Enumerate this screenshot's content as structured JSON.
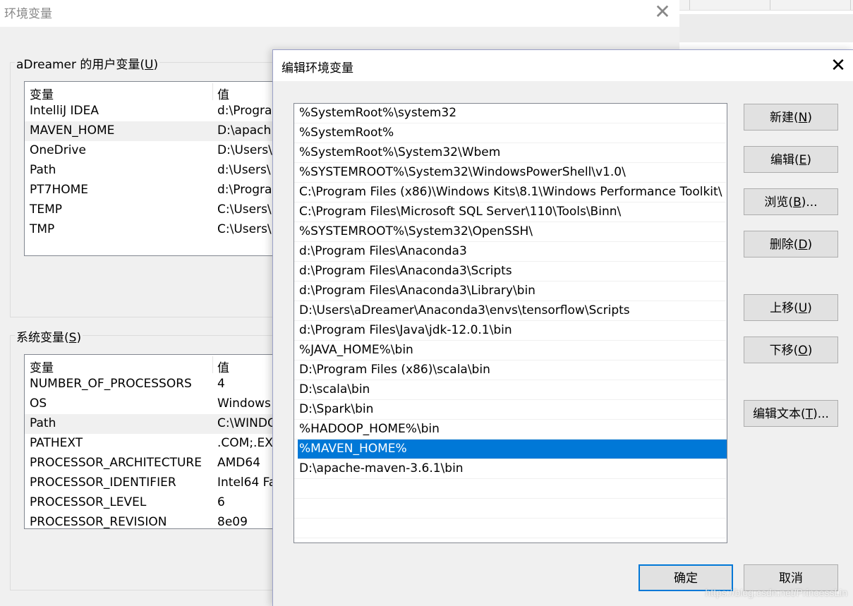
{
  "background_window": {
    "title": "环境变量",
    "user_group": {
      "label_prefix": "aDreamer 的用户变量(",
      "label_key": "U",
      "label_suffix": ")"
    },
    "user_table": {
      "headers": [
        "变量",
        "值"
      ],
      "rows": [
        {
          "name": "IntelliJ IDEA",
          "value": "d:\\Progra"
        },
        {
          "name": "MAVEN_HOME",
          "value": "D:\\apach"
        },
        {
          "name": "OneDrive",
          "value": "D:\\Users\\"
        },
        {
          "name": "Path",
          "value": "d:\\Users\\"
        },
        {
          "name": "PT7HOME",
          "value": "d:\\Progra"
        },
        {
          "name": "TEMP",
          "value": "C:\\Users\\"
        },
        {
          "name": "TMP",
          "value": "C:\\Users\\"
        }
      ]
    },
    "system_group": {
      "label_prefix": "系统变量(",
      "label_key": "S",
      "label_suffix": ")"
    },
    "system_table": {
      "headers": [
        "变量",
        "值"
      ],
      "rows": [
        {
          "name": "NUMBER_OF_PROCESSORS",
          "value": "4"
        },
        {
          "name": "OS",
          "value": "Windows"
        },
        {
          "name": "Path",
          "value": "C:\\WINDO"
        },
        {
          "name": "PATHEXT",
          "value": ".COM;.EX"
        },
        {
          "name": "PROCESSOR_ARCHITECTURE",
          "value": "AMD64"
        },
        {
          "name": "PROCESSOR_IDENTIFIER",
          "value": "Intel64 Fa"
        },
        {
          "name": "PROCESSOR_LEVEL",
          "value": "6"
        },
        {
          "name": "PROCESSOR_REVISION",
          "value": "8e09"
        }
      ]
    }
  },
  "dialog": {
    "title": "编辑环境变量",
    "paths": [
      "%SystemRoot%\\system32",
      "%SystemRoot%",
      "%SystemRoot%\\System32\\Wbem",
      "%SYSTEMROOT%\\System32\\WindowsPowerShell\\v1.0\\",
      "C:\\Program Files (x86)\\Windows Kits\\8.1\\Windows Performance Toolkit\\",
      "C:\\Program Files\\Microsoft SQL Server\\110\\Tools\\Binn\\",
      "%SYSTEMROOT%\\System32\\OpenSSH\\",
      "d:\\Program Files\\Anaconda3",
      "d:\\Program Files\\Anaconda3\\Scripts",
      "d:\\Program Files\\Anaconda3\\Library\\bin",
      "D:\\Users\\aDreamer\\Anaconda3\\envs\\tensorflow\\Scripts",
      "d:\\Program Files\\Java\\jdk-12.0.1\\bin",
      "%JAVA_HOME%\\bin",
      "D:\\Program Files (x86)\\scala\\bin",
      "D:\\scala\\bin",
      "D:\\Spark\\bin",
      "%HADOOP_HOME%\\bin",
      "%MAVEN_HOME%",
      "D:\\apache-maven-3.6.1\\bin",
      "",
      "",
      ""
    ],
    "selected_index": 17,
    "buttons": {
      "new": {
        "prefix": "新建(",
        "key": "N",
        "suffix": ")"
      },
      "edit": {
        "prefix": "编辑(",
        "key": "E",
        "suffix": ")"
      },
      "browse": {
        "prefix": "浏览(",
        "key": "B",
        "suffix": ")..."
      },
      "delete": {
        "prefix": "删除(",
        "key": "D",
        "suffix": ")"
      },
      "move_up": {
        "prefix": "上移(",
        "key": "U",
        "suffix": ")"
      },
      "move_down": {
        "prefix": "下移(",
        "key": "O",
        "suffix": ")"
      },
      "edit_text": {
        "prefix": "编辑文本(",
        "key": "T",
        "suffix": ")..."
      }
    },
    "ok_label": "确定",
    "cancel_label": "取消"
  },
  "watermark": "https://blog.csdn.net/PrincessLin",
  "colors": {
    "selection": "#0078d7",
    "dialog_bg": "#f0f0f0"
  },
  "icons": {
    "close": "close-icon"
  }
}
